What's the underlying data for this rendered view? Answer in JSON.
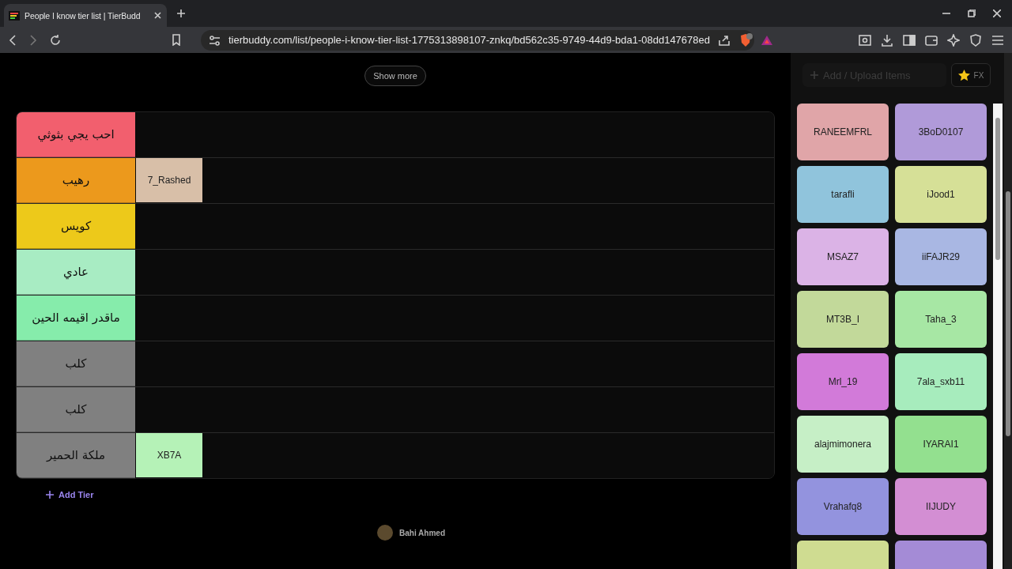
{
  "browser": {
    "tab_title": "People I know tier list | TierBudd",
    "url": "tierbuddy.com/list/people-i-know-tier-list-1775313898107-znkq/bd562c35-9749-44d9-bda1-08dd147678ed"
  },
  "show_more": "Show more",
  "tiers": [
    {
      "label": "احب يجي بثوثي",
      "color": "#f25f6e"
    },
    {
      "label": "رهيب",
      "color": "#ec991c",
      "items": [
        {
          "name": "7_Rashed",
          "color": "#d8bfa8"
        }
      ]
    },
    {
      "label": "كويس",
      "color": "#edc91a"
    },
    {
      "label": "عادي",
      "color": "#a8ecc3"
    },
    {
      "label": "ماقدر اقيمه الحين",
      "color": "#86ecab"
    },
    {
      "label": "كلب",
      "color": "#808080"
    },
    {
      "label": "كلب",
      "color": "#808080"
    },
    {
      "label": "ملكة الحمير",
      "color": "#808080",
      "items": [
        {
          "name": "XB7A",
          "color": "#b5f2b7"
        }
      ]
    }
  ],
  "add_tier": "Add Tier",
  "author": {
    "name": "Bahi Ahmed"
  },
  "sidebar": {
    "add_placeholder": "Add / Upload Items",
    "fx_label": "FX",
    "pool": [
      {
        "name": "RANEEMFRL",
        "color": "#e0a5a8"
      },
      {
        "name": "3BoD0107",
        "color": "#b09ad9"
      },
      {
        "name": "tarafli",
        "color": "#90c4dc"
      },
      {
        "name": "iJood1",
        "color": "#d6e097"
      },
      {
        "name": "MSAZ7",
        "color": "#dbb3e6"
      },
      {
        "name": "iiFAJR29",
        "color": "#a9b7e3"
      },
      {
        "name": "MT3B_I",
        "color": "#c2d99a"
      },
      {
        "name": "Taha_3",
        "color": "#a7e7a4"
      },
      {
        "name": "Mrl_19",
        "color": "#d27ad9"
      },
      {
        "name": "7ala_sxb11",
        "color": "#a7ecbd"
      },
      {
        "name": "alajmimonera",
        "color": "#c6efc6"
      },
      {
        "name": "IYARAI1",
        "color": "#93e08f"
      },
      {
        "name": "Vrahafq8",
        "color": "#9393de"
      },
      {
        "name": "IIJUDY",
        "color": "#d38ed3"
      },
      {
        "color": "#cfdc91"
      },
      {
        "color": "#a48bd6"
      }
    ]
  }
}
